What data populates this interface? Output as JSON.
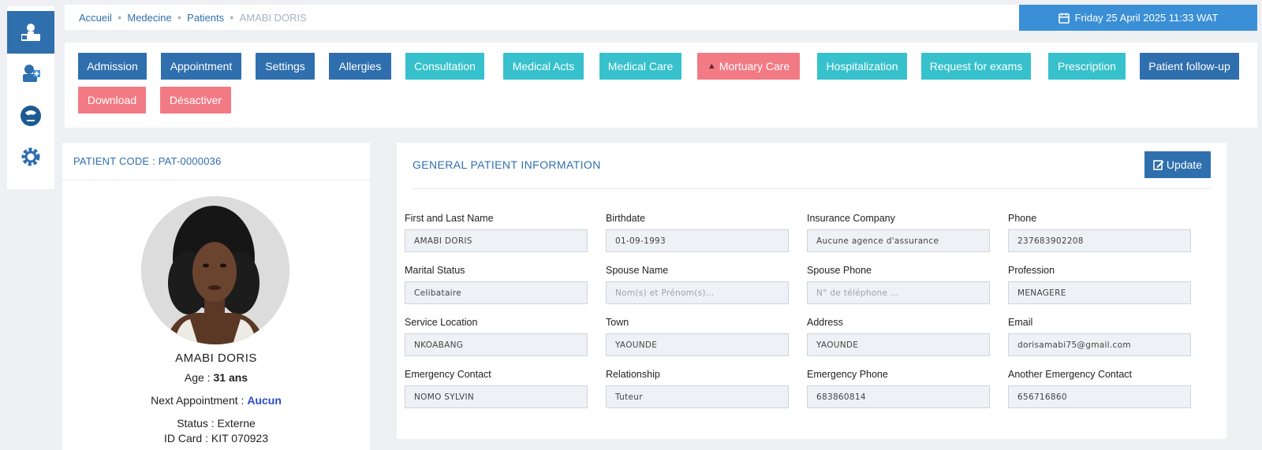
{
  "breadcrumb": [
    "Accueil",
    "Medecine",
    "Patients",
    "AMABI DORIS"
  ],
  "datetime": "Friday 25 April 2025 11:33 WAT",
  "sidebar": {
    "items": [
      {
        "icon": "patient-icon",
        "active": true
      },
      {
        "icon": "medical-icon",
        "active": false
      },
      {
        "icon": "globe-icon",
        "active": false
      },
      {
        "icon": "gear-icon",
        "active": false
      }
    ]
  },
  "actions": {
    "admission": "Admission",
    "appointment": "Appointment",
    "settings": "Settings",
    "allergies": "Allergies",
    "consultation": "Consultation",
    "medical_acts": "Medical Acts",
    "medical_care": "Medical Care",
    "mortuary_care": "Mortuary Care",
    "hospitalization": "Hospitalization",
    "request_exams": "Request for exams",
    "prescription": "Prescription",
    "patient_followup": "Patient follow-up",
    "download": "Download",
    "desactiver": "Désactiver"
  },
  "colors": {
    "dark": "#2f6fae",
    "teal": "#36c1cc",
    "pink": "#f27a84",
    "datetime": "#3a8fd6"
  },
  "patient": {
    "code_label": "PATIENT CODE :",
    "code": "PAT-0000036",
    "name": "AMABI DORIS",
    "age_label": "Age :",
    "age": "31 ans",
    "next_label": "Next Appointment :",
    "next": "Aucun",
    "status_label": "Status :",
    "status": "Externe",
    "id_label": "ID Card :",
    "id": "KIT 070923"
  },
  "info": {
    "title": "GENERAL PATIENT INFORMATION",
    "update": "Update",
    "fields": [
      {
        "label": "First and Last Name",
        "value": "AMABI DORIS",
        "placeholder": false
      },
      {
        "label": "Birthdate",
        "value": "01-09-1993",
        "placeholder": false
      },
      {
        "label": "Insurance Company",
        "value": "Aucune agence d'assurance",
        "placeholder": false
      },
      {
        "label": "Phone",
        "value": "237683902208",
        "placeholder": false
      },
      {
        "label": "Marital Status",
        "value": "Celibataire",
        "placeholder": false
      },
      {
        "label": "Spouse Name",
        "value": "Nom(s) et Prénom(s)...",
        "placeholder": true
      },
      {
        "label": "Spouse Phone",
        "value": "N° de téléphone ...",
        "placeholder": true
      },
      {
        "label": "Profession",
        "value": "MENAGERE",
        "placeholder": false
      },
      {
        "label": "Service Location",
        "value": "NKOABANG",
        "placeholder": false
      },
      {
        "label": "Town",
        "value": "YAOUNDE",
        "placeholder": false
      },
      {
        "label": "Address",
        "value": "YAOUNDE",
        "placeholder": false
      },
      {
        "label": "Email",
        "value": "dorisamabi75@gmail.com",
        "placeholder": false
      },
      {
        "label": "Emergency Contact",
        "value": "NOMO SYLVIN",
        "placeholder": false
      },
      {
        "label": "Relationship",
        "value": "Tuteur",
        "placeholder": false
      },
      {
        "label": "Emergency Phone",
        "value": "683860814",
        "placeholder": false
      },
      {
        "label": "Another Emergency Contact",
        "value": "656716860",
        "placeholder": false
      }
    ]
  }
}
